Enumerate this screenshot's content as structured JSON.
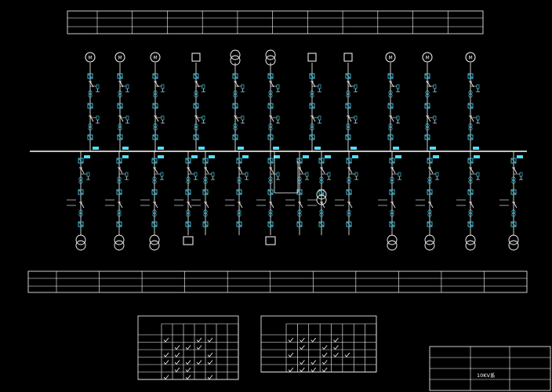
{
  "notes": {
    "title_block_name": "10KV系"
  },
  "colors": {
    "background": "#000000",
    "line": "#ffffff",
    "device": "#4fe0ff",
    "check": "#ffffff",
    "annotation": "#e8e8e8"
  }
}
